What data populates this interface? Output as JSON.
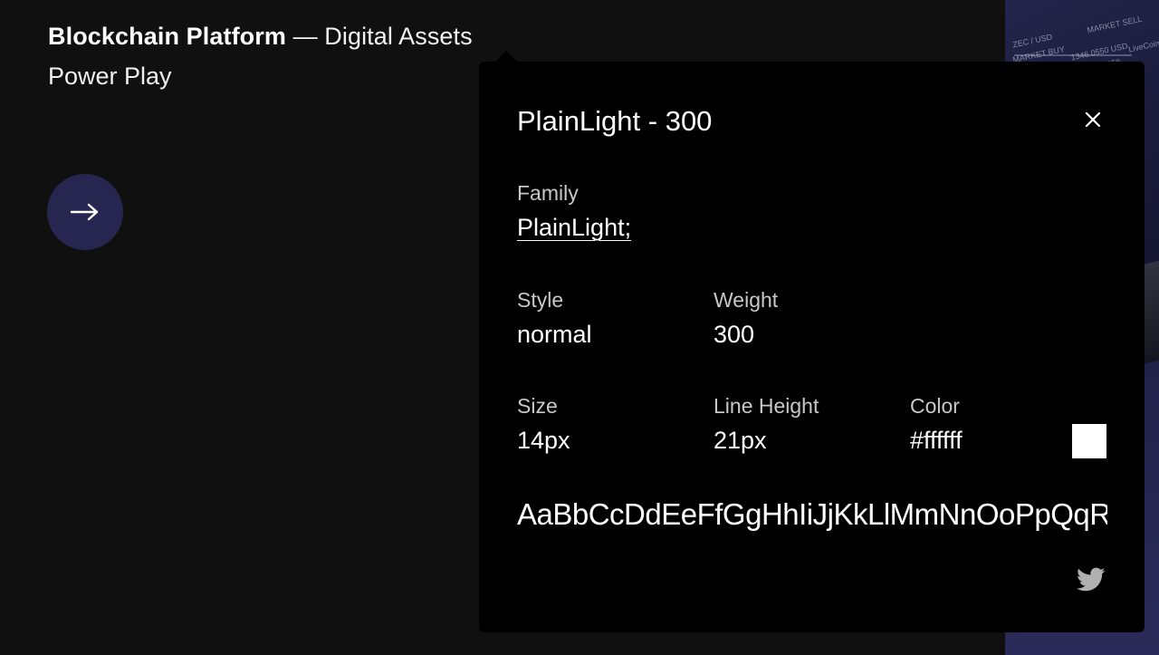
{
  "header": {
    "title_bold": "Blockchain Platform",
    "title_rest": " — Digital Assets",
    "subtitle": "Power Play"
  },
  "arrow_button": {
    "icon": "arrow-right-icon"
  },
  "background": {
    "texts": [
      "MARKET SELL",
      "MARKET BUY",
      "ZEC / USD",
      "1346.0550 USD",
      "0.0258",
      "LiveCoin"
    ]
  },
  "popup": {
    "title": "PlainLight - 300",
    "family_label": "Family",
    "family_value": "PlainLight;",
    "style_label": "Style",
    "style_value": "normal",
    "weight_label": "Weight",
    "weight_value": "300",
    "size_label": "Size",
    "size_value": "14px",
    "line_height_label": "Line Height",
    "line_height_value": "21px",
    "color_label": "Color",
    "color_value": "#ffffff",
    "swatch_color": "#ffffff",
    "sample": "AaBbCcDdEeFfGgHhIiJjKkLlMmNnOoPpQqRrSsTtUuVvWwXxYyZz",
    "close_icon": "close-icon",
    "share_icon": "twitter-icon"
  },
  "colors": {
    "page_background": "#101010",
    "popup_background": "#000000",
    "button_background": "#262650",
    "label_color": "#c8c8c8"
  }
}
